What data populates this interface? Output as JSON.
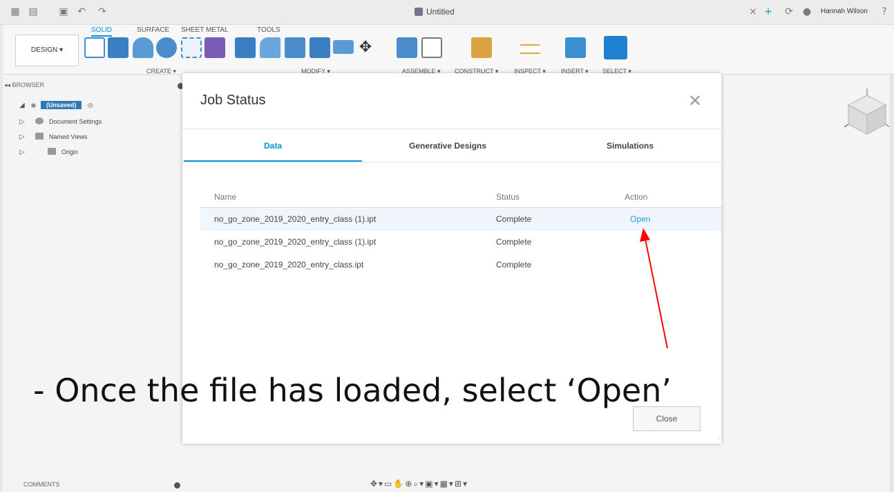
{
  "window": {
    "document_title": "Untitled",
    "user_name": "Hannah Wilson"
  },
  "toolbar": {
    "tabs": [
      "SOLID",
      "SURFACE",
      "SHEET METAL",
      "TOOLS"
    ],
    "active_tab": "SOLID",
    "workspace_button": "DESIGN ▾",
    "groups": {
      "create": "CREATE ▾",
      "modify": "MODIFY ▾",
      "assemble": "ASSEMBLE ▾",
      "construct": "CONSTRUCT ▾",
      "inspect": "INSPECT ▾",
      "insert": "INSERT ▾",
      "select": "SELECT ▾"
    }
  },
  "browser": {
    "header": "BROWSER",
    "root_badge": "(Unsaved)",
    "items": [
      "Document Settings",
      "Named Views",
      "Origin"
    ]
  },
  "modal": {
    "title": "Job Status",
    "tabs": [
      "Data",
      "Generative Designs",
      "Simulations"
    ],
    "active_tab": "Data",
    "columns": [
      "Name",
      "Status",
      "Action"
    ],
    "rows": [
      {
        "name": "no_go_zone_2019_2020_entry_class (1).ipt",
        "status": "Complete",
        "action": "Open"
      },
      {
        "name": "no_go_zone_2019_2020_entry_class (1).ipt",
        "status": "Complete",
        "action": ""
      },
      {
        "name": "no_go_zone_2019_2020_entry_class.ipt",
        "status": "Complete",
        "action": ""
      }
    ],
    "close_button": "Close"
  },
  "caption": "-   Once the file has loaded, select ‘Open’",
  "bottom": {
    "comments": "COMMENTS"
  },
  "colors": {
    "accent": "#0696d7",
    "link": "#1aa3d9",
    "arrow": "#ff0000",
    "unsaved_badge": "#2f79b7"
  }
}
